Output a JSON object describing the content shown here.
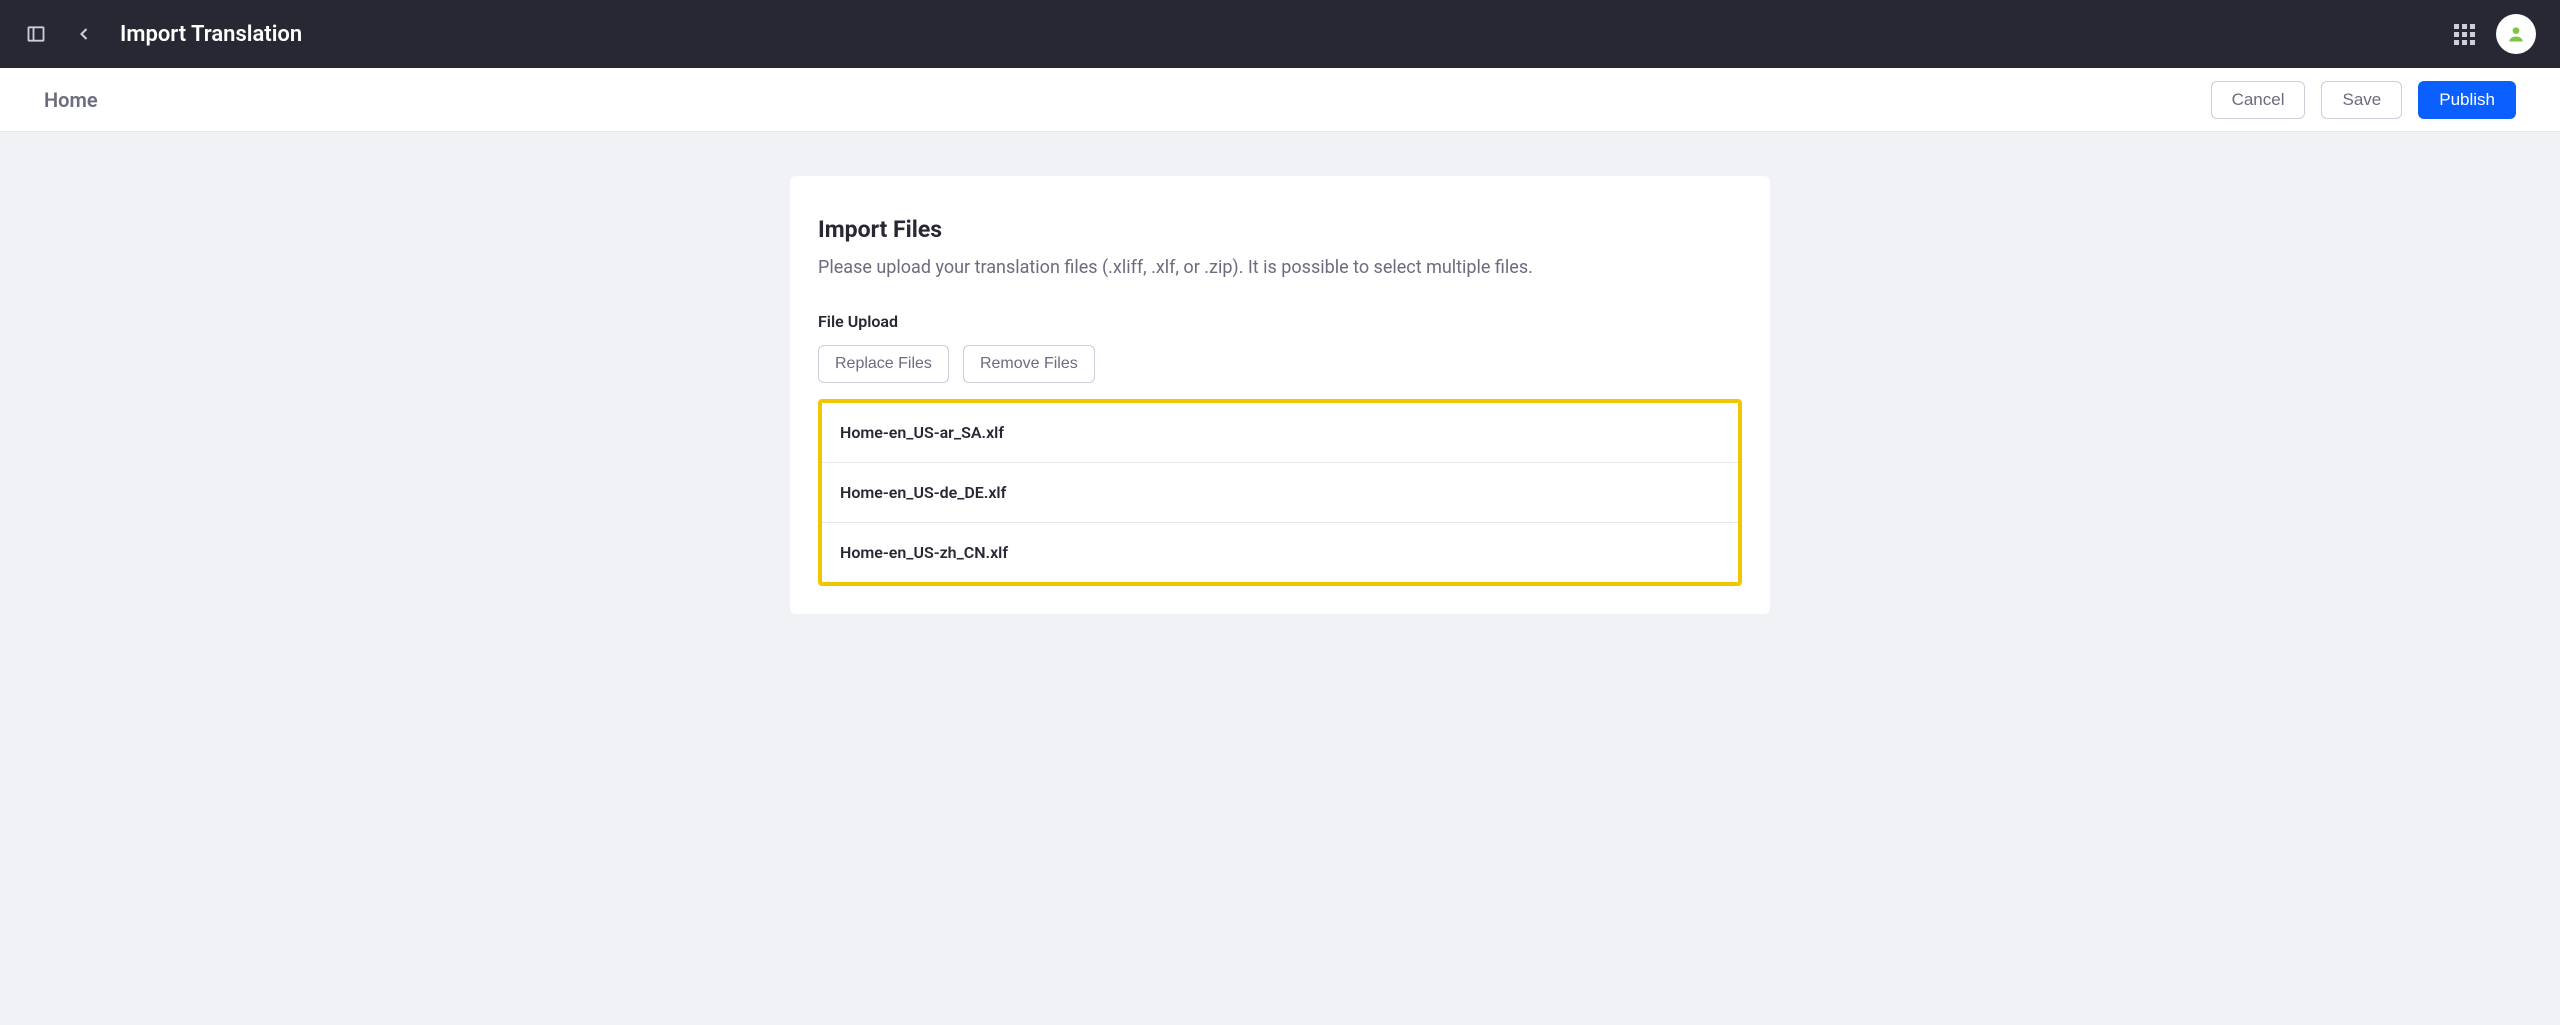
{
  "header": {
    "title": "Import Translation"
  },
  "subheader": {
    "breadcrumb": "Home",
    "actions": {
      "cancel": "Cancel",
      "save": "Save",
      "publish": "Publish"
    }
  },
  "main": {
    "card_title": "Import Files",
    "card_subtitle": "Please upload your translation files (.xliff, .xlf, or .zip). It is possible to select multiple files.",
    "field_label": "File Upload",
    "replace_btn": "Replace Files",
    "remove_btn": "Remove Files",
    "files": [
      "Home-en_US-ar_SA.xlf",
      "Home-en_US-de_DE.xlf",
      "Home-en_US-zh_CN.xlf"
    ]
  }
}
